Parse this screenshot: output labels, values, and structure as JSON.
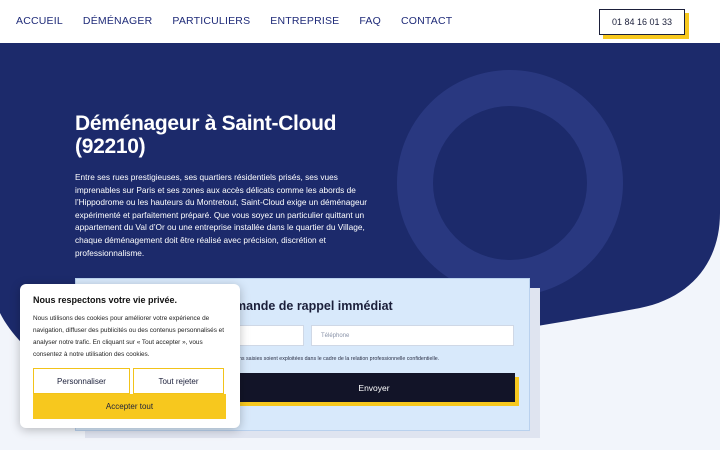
{
  "nav": {
    "items": [
      "ACCUEIL",
      "DÉMÉNAGER",
      "PARTICULIERS",
      "ENTREPRISE",
      "FAQ",
      "CONTACT"
    ],
    "phone": "01 84 16 01 33"
  },
  "hero": {
    "title": "Déménageur à Saint-Cloud (92210)",
    "intro": "Entre ses rues prestigieuses, ses quartiers résidentiels prisés, ses vues imprenables sur Paris et ses zones aux accès délicats comme les abords de l’Hippodrome ou les hauteurs du Montretout, Saint-Cloud exige un déménageur expérimenté et parfaitement préparé. Que vous soyez un particulier quittant un appartement du Val d’Or ou une entreprise installée dans le quartier du Village, chaque déménagement doit être réalisé avec précision, discrétion et professionnalisme."
  },
  "form": {
    "title": "mande de rappel immédiat",
    "phone_placeholder": "Téléphone",
    "consent": "ons saisies soient exploitées dans le cadre de la relation professionnelle confidentielle.",
    "submit": "Envoyer"
  },
  "cookie": {
    "title": "Nous respectons votre vie privée.",
    "text": "Nous utilisons des cookies pour améliorer votre expérience de navigation, diffuser des publicités ou des contenus personnalisés et analyser notre trafic. En cliquant sur « Tout accepter », vous consentez à notre utilisation des cookies.",
    "personalize": "Personnaliser",
    "reject": "Tout rejeter",
    "accept": "Accepter tout"
  },
  "colors": {
    "navy": "#1c2a6b",
    "accent": "#f7c81e",
    "dark": "#121428"
  }
}
